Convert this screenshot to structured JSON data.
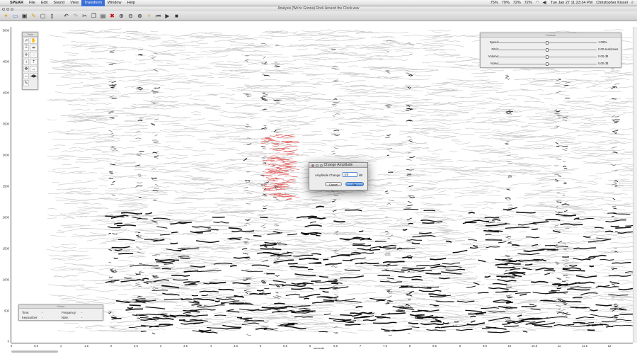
{
  "menubar": {
    "apple": "",
    "app_name": "SPEAR",
    "items": [
      "File",
      "Edit",
      "Sound",
      "View",
      "Transform",
      "Window",
      "Help"
    ],
    "active_item": "Transform",
    "status": {
      "cpu1": "75%",
      "cpu2": "79%",
      "cpu3": "72%",
      "cpu4": "72%",
      "datetime": "Tue Jan 27  11:23:34 PM",
      "user": "Christopher Kissel"
    }
  },
  "window": {
    "title": "Analysis (We're Gonna) Rock Around the Clock.wav"
  },
  "plot": {
    "y_ticks": [
      "5000",
      "4500",
      "4000",
      "3500",
      "3000",
      "2500",
      "2000",
      "1500",
      "1000",
      "500",
      "0"
    ],
    "x_ticks": [
      "0",
      "0.5",
      "1",
      "1.5",
      "2",
      "2.5",
      "3",
      "3.5",
      "4",
      "4.5",
      "5",
      "5.5",
      "6",
      "6.5",
      "7",
      "7.5",
      "8",
      "8.5",
      "9",
      "9.5",
      "10",
      "10.5",
      "11",
      "11.5",
      "12"
    ],
    "x_label": "seconds"
  },
  "tools_palette": {
    "title": "Tools"
  },
  "controls": {
    "title": "Controls",
    "rows": [
      {
        "label": "Speed:",
        "value": "1.000x"
      },
      {
        "label": "Pitch:",
        "value": "0.00 semitones"
      },
      {
        "label": "Volume:",
        "value": "0.00 dB"
      },
      {
        "label": "Noise:",
        "value": "0.00 dB"
      }
    ]
  },
  "cursor_panel": {
    "title": "Cursor",
    "time_label": "Time:",
    "time_value": "-",
    "keynumber_label": "Keynumber:",
    "keynumber_value": "-",
    "frequency_label": "Frequency:",
    "frequency_value": "-",
    "note_label": "Note:",
    "note_value": "-"
  },
  "dialog": {
    "title": "Change Amplitude",
    "field_label": "Amplitude Change:",
    "field_value": "-20",
    "unit": "dB",
    "cancel": "Cancel",
    "ok": "OK"
  },
  "colors": {
    "partial_light": "#c8c8c8",
    "partial_dark": "#111111",
    "selection": "#e06060",
    "menu_highlight": "#3a6fd8"
  }
}
